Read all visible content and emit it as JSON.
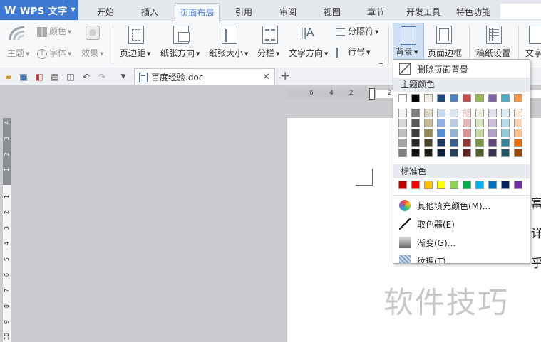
{
  "app": {
    "title": "WPS 文字",
    "logo": "W"
  },
  "tabs": [
    {
      "label": "开始",
      "active": false
    },
    {
      "label": "插入",
      "active": false
    },
    {
      "label": "页面布局",
      "active": true
    },
    {
      "label": "引用",
      "active": false
    },
    {
      "label": "审阅",
      "active": false
    },
    {
      "label": "视图",
      "active": false
    },
    {
      "label": "章节",
      "active": false
    },
    {
      "label": "开发工具",
      "active": false
    },
    {
      "label": "特色功能",
      "active": false
    }
  ],
  "ribbon": {
    "theme_color": "颜色",
    "theme": "主题",
    "font": "字体",
    "effect": "效果",
    "margins": "页边距",
    "orientation": "纸张方向",
    "size": "纸张大小",
    "columns": "分栏",
    "text_direction": "文字方向",
    "separator": "分隔符",
    "line_number": "行号",
    "background": "背景",
    "page_border": "页面边框",
    "paper_settings": "稿纸设置",
    "text_cut": "文字"
  },
  "document": {
    "tab_name": "百度经验.doc",
    "chars": [
      "富",
      "详",
      "乎"
    ]
  },
  "ruler": {
    "h_ticks": [
      "6",
      "4",
      "2",
      "2"
    ],
    "v_ticks": [
      "4",
      "3",
      "2",
      "1",
      "1",
      "2",
      "3",
      "4",
      "5",
      "6",
      "7",
      "8",
      "9",
      "10"
    ]
  },
  "dropdown": {
    "delete_bg": "删除页面背景",
    "theme_colors_label": "主题颜色",
    "standard_colors_label": "标准色",
    "more_fill": "其他填充颜色(M)...",
    "eyedropper": "取色器(E)",
    "gradient": "渐变(G)...",
    "texture": "纹理(T)",
    "theme_top": [
      "#ffffff",
      "#000000",
      "#eeece1",
      "#1f497d",
      "#4f81bd",
      "#c0504d",
      "#9bbb59",
      "#8064a2",
      "#4bacc6",
      "#f79646"
    ],
    "theme_shades": [
      [
        "#f2f2f2",
        "#7f7f7f",
        "#ddd9c3",
        "#c6d9f0",
        "#dbe5f1",
        "#f2dcdb",
        "#ebf1dd",
        "#e5e0ec",
        "#dbeef3",
        "#fdeada"
      ],
      [
        "#d8d8d8",
        "#595959",
        "#c4bd97",
        "#8db3e2",
        "#b8cce4",
        "#e5b9b7",
        "#d7e3bc",
        "#ccc1d9",
        "#b7dde8",
        "#fbd5b5"
      ],
      [
        "#bfbfbf",
        "#3f3f3f",
        "#938953",
        "#548dd4",
        "#95b3d7",
        "#d99694",
        "#c3d69b",
        "#b2a2c7",
        "#92cddc",
        "#fac08f"
      ],
      [
        "#a5a5a5",
        "#262626",
        "#494429",
        "#17365d",
        "#366092",
        "#953734",
        "#76923c",
        "#5f497a",
        "#31859b",
        "#e36c09"
      ],
      [
        "#7f7f7f",
        "#0c0c0c",
        "#1d1b10",
        "#0f243e",
        "#244061",
        "#632423",
        "#4f6128",
        "#3f3151",
        "#205867",
        "#974806"
      ]
    ],
    "standard": [
      "#c00000",
      "#ff0000",
      "#ffc000",
      "#ffff00",
      "#92d050",
      "#00b050",
      "#00b0f0",
      "#0070c0",
      "#002060",
      "#7030a0"
    ]
  },
  "watermark": "软件技巧"
}
